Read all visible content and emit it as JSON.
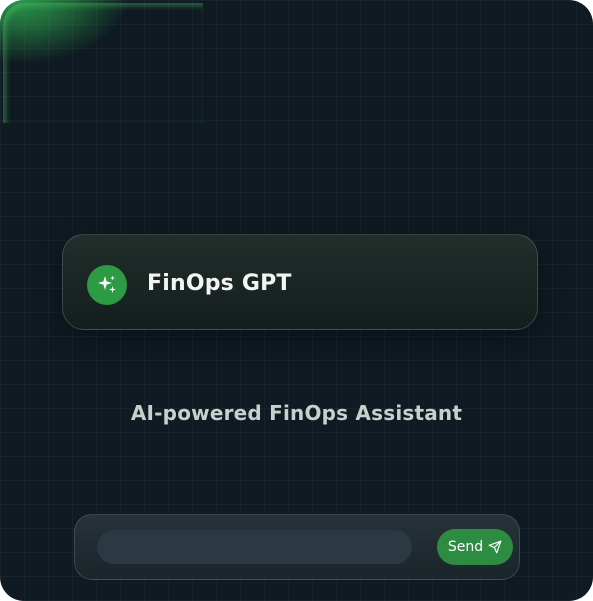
{
  "app": {
    "title": "FinOps GPT",
    "subtitle": "AI-powered FinOps Assistant",
    "logo_icon": "sparkles-icon"
  },
  "composer": {
    "input_value": "",
    "input_placeholder": "",
    "send_label": "Send",
    "send_icon": "paper-plane-icon"
  },
  "colors": {
    "background": "#0f1a22",
    "accent": "#2d9a44",
    "send_button": "#2d8c42",
    "title_text": "#f3f5f4",
    "subtitle_text": "#c9cfcd"
  }
}
